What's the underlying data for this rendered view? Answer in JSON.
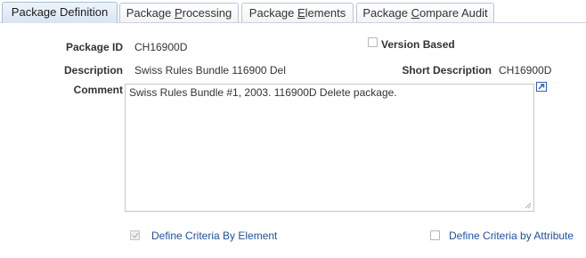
{
  "tabs": [
    {
      "label": "Package Definition",
      "active": true
    },
    {
      "label": "Package Processing",
      "pre": "Package ",
      "ul": "P",
      "post": "rocessing"
    },
    {
      "label": "Package Elements",
      "pre": "Package ",
      "ul": "E",
      "post": "lements"
    },
    {
      "label": "Package Compare Audit",
      "pre": "Package ",
      "ul": "C",
      "post": "ompare Audit"
    }
  ],
  "form": {
    "package_id_label": "Package ID",
    "package_id_value": "CH16900D",
    "version_based_label": "Version Based",
    "version_based_checked": false,
    "description_label": "Description",
    "description_value": "Swiss Rules Bundle 116900 Del",
    "short_description_label": "Short Description",
    "short_description_value": "CH16900D",
    "comment_label": "Comment",
    "comment_value": "Swiss Rules Bundle  #1, 2003. 116900D  Delete package."
  },
  "criteria": {
    "by_element_label": "Define Criteria By Element",
    "by_element_checked": true,
    "by_attribute_label": "Define Criteria by Attribute",
    "by_attribute_checked": false
  },
  "icons": {
    "expand": "expand-textarea-icon",
    "resize": "resize-grip-icon"
  },
  "colors": {
    "link": "#1f4f9c",
    "active_tab": "#d9e5f2",
    "tab_border": "#b8c4d2"
  }
}
